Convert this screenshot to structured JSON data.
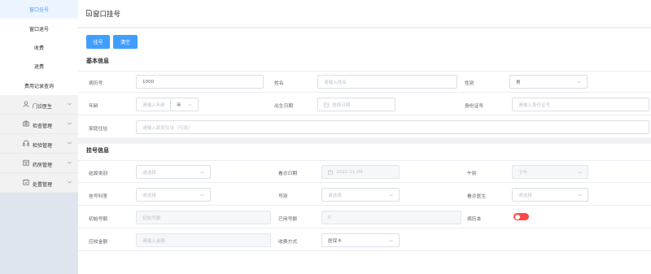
{
  "sidebar": {
    "items": [
      {
        "label": "窗口挂号",
        "active": true
      },
      {
        "label": "窗口退号"
      },
      {
        "label": "收费"
      },
      {
        "label": "退费"
      },
      {
        "label": "费用记录查询"
      }
    ],
    "groups": [
      {
        "label": "门诊医生",
        "icon": "user-icon"
      },
      {
        "label": "检查管理",
        "icon": "camera-icon"
      },
      {
        "label": "检验管理",
        "icon": "headset-icon"
      },
      {
        "label": "药房管理",
        "icon": "pharmacy-icon"
      },
      {
        "label": "处置管理",
        "icon": "calendar-icon"
      }
    ]
  },
  "header": {
    "title": "窗口挂号",
    "icon": "document-icon"
  },
  "toolbar": {
    "register_label": "挂号",
    "clear_label": "清空"
  },
  "basic_info": {
    "title": "基本信息",
    "record_no_label": "病历号",
    "record_no_value": "1000",
    "name_label": "姓名",
    "name_placeholder": "请输入姓名",
    "gender_label": "性别",
    "gender_value": "男",
    "age_label": "年龄",
    "age_placeholder": "请输入年龄",
    "age_unit": "年",
    "birth_label": "出生日期",
    "birth_placeholder": "选择日期",
    "idcard_label": "身份证号",
    "idcard_placeholder": "请输入身份证号",
    "address_label": "家庭住址",
    "address_placeholder": "请输入家庭住址（可选）"
  },
  "register_info": {
    "title": "挂号信息",
    "settle_label": "结算类别",
    "settle_placeholder": "请选择",
    "visit_date_label": "看诊日期",
    "visit_date_value": "2022-11-09",
    "noon_label": "午别",
    "noon_value": "下午",
    "dept_label": "挂号科室",
    "dept_placeholder": "请选择",
    "level_label": "号别",
    "level_placeholder": "请选择",
    "doctor_label": "看诊医生",
    "doctor_placeholder": "请选择",
    "init_count_label": "初始号额",
    "init_count_placeholder": "初始号额",
    "used_count_label": "已用号额",
    "used_count_value": "0",
    "record_book_label": "病历本",
    "amount_label": "应收金额",
    "amount_placeholder": "请输入金额",
    "pay_label": "收费方式",
    "pay_value": "医保卡"
  },
  "colors": {
    "primary": "#409eff",
    "toggle": "#ff4949",
    "sidebar_bg": "#dfe5ee"
  }
}
